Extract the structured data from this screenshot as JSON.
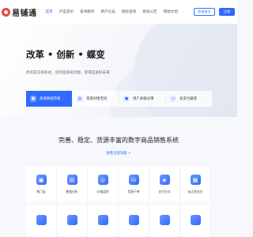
{
  "nav": {
    "logo_text": "易铺通",
    "links": [
      "首页",
      "产品定价",
      "技术服务",
      "用户论坛",
      "授权查询",
      "系统公告",
      "帮助文档"
    ],
    "login_label": "登录账号",
    "register_label": "注册"
  },
  "hero": {
    "title": "改革 • 创新 • 蝶变",
    "subtitle": "改的是交易形式，创的是系统功能，变得是美好未来",
    "features": [
      {
        "label": "商城系统完善",
        "icon": "store-icon"
      },
      {
        "label": "资源对接无忧",
        "icon": "link-icon"
      },
      {
        "label": "用户多级分销",
        "icon": "user-icon"
      },
      {
        "label": "多支付通道",
        "icon": "card-icon"
      }
    ]
  },
  "section": {
    "title": "完善、稳定、货源丰富的数字商品销售系统",
    "link": "查看全部功能 >"
  },
  "cards": [
    {
      "label": "独门店",
      "glyph": "▣",
      "icon": "shop-icon"
    },
    {
      "label": "数据分析",
      "glyph": "▤",
      "icon": "chart-icon"
    },
    {
      "label": "价格监控",
      "glyph": "◎",
      "icon": "monitor-icon"
    },
    {
      "label": "货源下单",
      "glyph": "⛁",
      "icon": "order-icon"
    },
    {
      "label": "支付方式",
      "glyph": "◈",
      "icon": "pay-icon"
    },
    {
      "label": "站点多支付",
      "glyph": "▦",
      "icon": "site-icon"
    }
  ]
}
